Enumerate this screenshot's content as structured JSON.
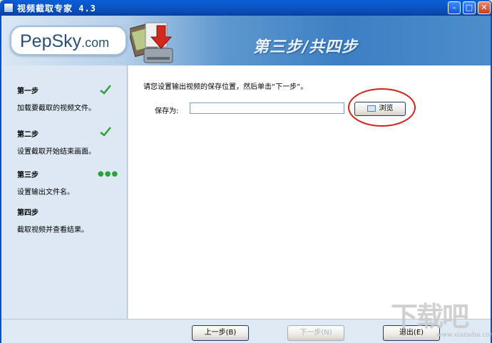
{
  "window": {
    "title": "视频截取专家 4.3",
    "controls": {
      "minimize": "–",
      "maximize": "□",
      "close": "✕"
    }
  },
  "header": {
    "logo_main": "PepSky",
    "logo_domain": ".com",
    "step_title": "第三步/共四步"
  },
  "sidebar": {
    "steps": [
      {
        "title": "第一步",
        "desc": "加载要截取的视频文件。",
        "status": "done"
      },
      {
        "title": "第二步",
        "desc": "设置截取开始结束画面。",
        "status": "done"
      },
      {
        "title": "第三步",
        "desc": "设置输出文件名。",
        "status": "current",
        "indicator": "●●●"
      },
      {
        "title": "第四步",
        "desc": "截取视频并查看结果。",
        "status": "pending"
      }
    ]
  },
  "main": {
    "prompt": "请您设置输出视频的保存位置，然后单击“下一步”。",
    "save_label": "保存为:",
    "path_value": "",
    "browse_label": "浏览"
  },
  "footer": {
    "prev_label": "上一步(B)",
    "next_label": "下一步(N)",
    "exit_label": "退出(E)"
  },
  "watermark": {
    "text": "下载吧",
    "url": "www.xiazaiba.com"
  },
  "colors": {
    "title_bar": "#0a55c4",
    "check": "#2aa43a",
    "annotation_circle": "#d4201b"
  }
}
